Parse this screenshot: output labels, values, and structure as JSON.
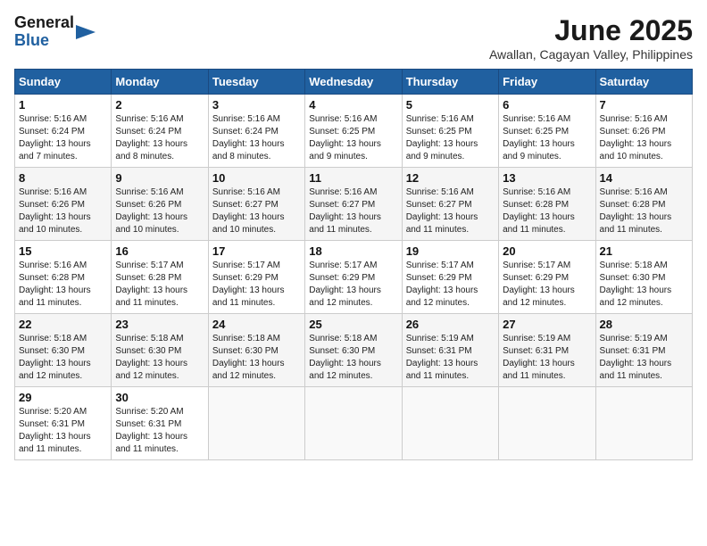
{
  "header": {
    "logo_general": "General",
    "logo_blue": "Blue",
    "month_title": "June 2025",
    "location": "Awallan, Cagayan Valley, Philippines"
  },
  "weekdays": [
    "Sunday",
    "Monday",
    "Tuesday",
    "Wednesday",
    "Thursday",
    "Friday",
    "Saturday"
  ],
  "weeks": [
    [
      {
        "day": "1",
        "sunrise": "5:16 AM",
        "sunset": "6:24 PM",
        "daylight": "13 hours and 7 minutes."
      },
      {
        "day": "2",
        "sunrise": "5:16 AM",
        "sunset": "6:24 PM",
        "daylight": "13 hours and 8 minutes."
      },
      {
        "day": "3",
        "sunrise": "5:16 AM",
        "sunset": "6:24 PM",
        "daylight": "13 hours and 8 minutes."
      },
      {
        "day": "4",
        "sunrise": "5:16 AM",
        "sunset": "6:25 PM",
        "daylight": "13 hours and 9 minutes."
      },
      {
        "day": "5",
        "sunrise": "5:16 AM",
        "sunset": "6:25 PM",
        "daylight": "13 hours and 9 minutes."
      },
      {
        "day": "6",
        "sunrise": "5:16 AM",
        "sunset": "6:25 PM",
        "daylight": "13 hours and 9 minutes."
      },
      {
        "day": "7",
        "sunrise": "5:16 AM",
        "sunset": "6:26 PM",
        "daylight": "13 hours and 10 minutes."
      }
    ],
    [
      {
        "day": "8",
        "sunrise": "5:16 AM",
        "sunset": "6:26 PM",
        "daylight": "13 hours and 10 minutes."
      },
      {
        "day": "9",
        "sunrise": "5:16 AM",
        "sunset": "6:26 PM",
        "daylight": "13 hours and 10 minutes."
      },
      {
        "day": "10",
        "sunrise": "5:16 AM",
        "sunset": "6:27 PM",
        "daylight": "13 hours and 10 minutes."
      },
      {
        "day": "11",
        "sunrise": "5:16 AM",
        "sunset": "6:27 PM",
        "daylight": "13 hours and 11 minutes."
      },
      {
        "day": "12",
        "sunrise": "5:16 AM",
        "sunset": "6:27 PM",
        "daylight": "13 hours and 11 minutes."
      },
      {
        "day": "13",
        "sunrise": "5:16 AM",
        "sunset": "6:28 PM",
        "daylight": "13 hours and 11 minutes."
      },
      {
        "day": "14",
        "sunrise": "5:16 AM",
        "sunset": "6:28 PM",
        "daylight": "13 hours and 11 minutes."
      }
    ],
    [
      {
        "day": "15",
        "sunrise": "5:16 AM",
        "sunset": "6:28 PM",
        "daylight": "13 hours and 11 minutes."
      },
      {
        "day": "16",
        "sunrise": "5:17 AM",
        "sunset": "6:28 PM",
        "daylight": "13 hours and 11 minutes."
      },
      {
        "day": "17",
        "sunrise": "5:17 AM",
        "sunset": "6:29 PM",
        "daylight": "13 hours and 11 minutes."
      },
      {
        "day": "18",
        "sunrise": "5:17 AM",
        "sunset": "6:29 PM",
        "daylight": "13 hours and 12 minutes."
      },
      {
        "day": "19",
        "sunrise": "5:17 AM",
        "sunset": "6:29 PM",
        "daylight": "13 hours and 12 minutes."
      },
      {
        "day": "20",
        "sunrise": "5:17 AM",
        "sunset": "6:29 PM",
        "daylight": "13 hours and 12 minutes."
      },
      {
        "day": "21",
        "sunrise": "5:18 AM",
        "sunset": "6:30 PM",
        "daylight": "13 hours and 12 minutes."
      }
    ],
    [
      {
        "day": "22",
        "sunrise": "5:18 AM",
        "sunset": "6:30 PM",
        "daylight": "13 hours and 12 minutes."
      },
      {
        "day": "23",
        "sunrise": "5:18 AM",
        "sunset": "6:30 PM",
        "daylight": "13 hours and 12 minutes."
      },
      {
        "day": "24",
        "sunrise": "5:18 AM",
        "sunset": "6:30 PM",
        "daylight": "13 hours and 12 minutes."
      },
      {
        "day": "25",
        "sunrise": "5:18 AM",
        "sunset": "6:30 PM",
        "daylight": "13 hours and 12 minutes."
      },
      {
        "day": "26",
        "sunrise": "5:19 AM",
        "sunset": "6:31 PM",
        "daylight": "13 hours and 11 minutes."
      },
      {
        "day": "27",
        "sunrise": "5:19 AM",
        "sunset": "6:31 PM",
        "daylight": "13 hours and 11 minutes."
      },
      {
        "day": "28",
        "sunrise": "5:19 AM",
        "sunset": "6:31 PM",
        "daylight": "13 hours and 11 minutes."
      }
    ],
    [
      {
        "day": "29",
        "sunrise": "5:20 AM",
        "sunset": "6:31 PM",
        "daylight": "13 hours and 11 minutes."
      },
      {
        "day": "30",
        "sunrise": "5:20 AM",
        "sunset": "6:31 PM",
        "daylight": "13 hours and 11 minutes."
      },
      null,
      null,
      null,
      null,
      null
    ]
  ],
  "labels": {
    "sunrise": "Sunrise:",
    "sunset": "Sunset:",
    "daylight": "Daylight:"
  }
}
